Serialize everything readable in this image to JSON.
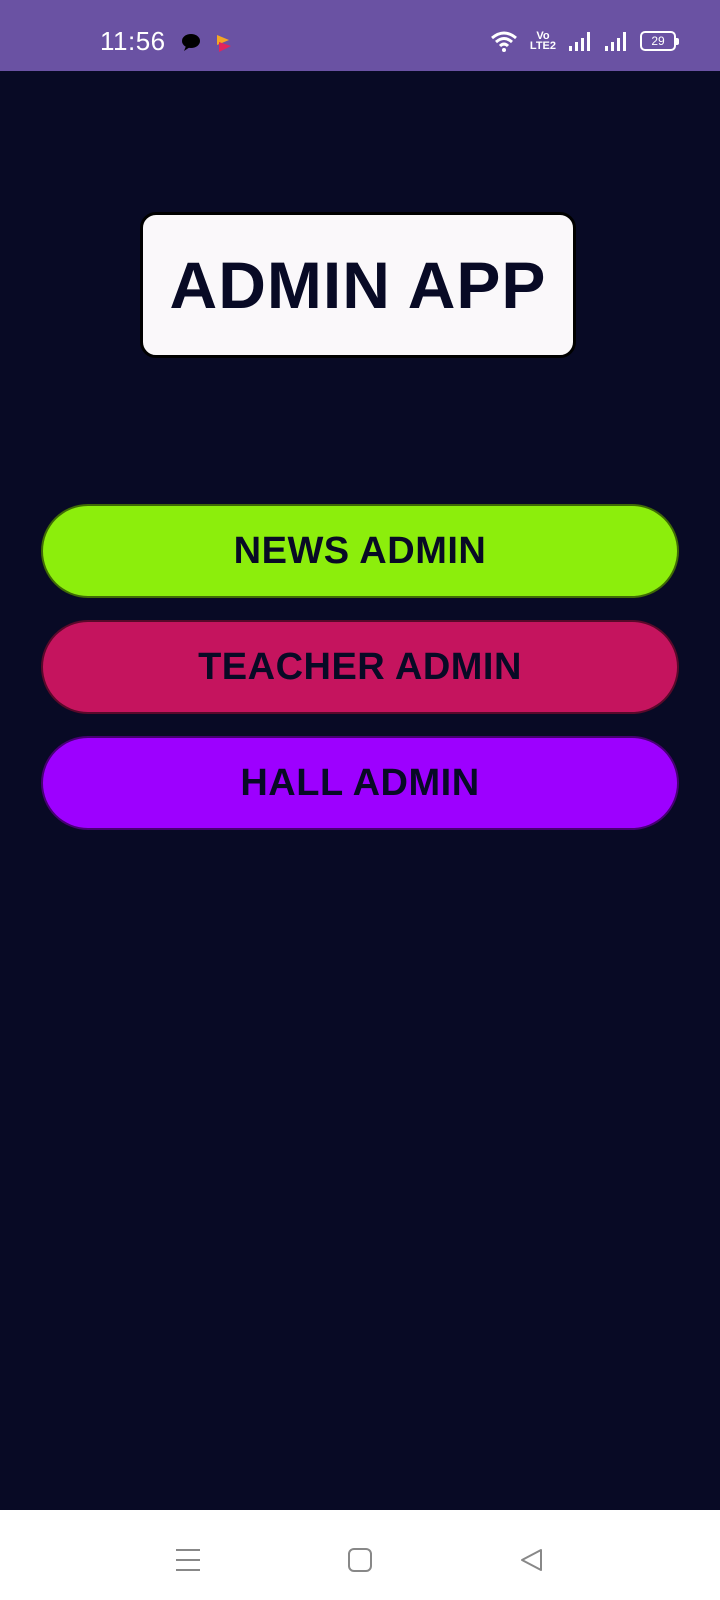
{
  "status_bar": {
    "time": "11:56",
    "notification_icons": [
      "chat-bubble-icon",
      "app-notification-icon"
    ],
    "volte_line1": "Vo",
    "volte_line2": "LTE2",
    "battery_level": "29",
    "system_icons": [
      "wifi-icon",
      "volte-icon",
      "signal-icon",
      "signal-icon",
      "battery-icon"
    ]
  },
  "app": {
    "title": "ADMIN APP"
  },
  "buttons": [
    {
      "label": "NEWS ADMIN",
      "color": "#8cee0c"
    },
    {
      "label": "TEACHER ADMIN",
      "color": "#c5145e"
    },
    {
      "label": "HALL ADMIN",
      "color": "#9d00ff"
    }
  ],
  "navigation_bar": {
    "items": [
      "menu-icon",
      "home-icon",
      "back-icon"
    ]
  },
  "colors": {
    "status_bar": "#6a52a3",
    "background": "#080a25",
    "title_box": "#faf8fa"
  }
}
